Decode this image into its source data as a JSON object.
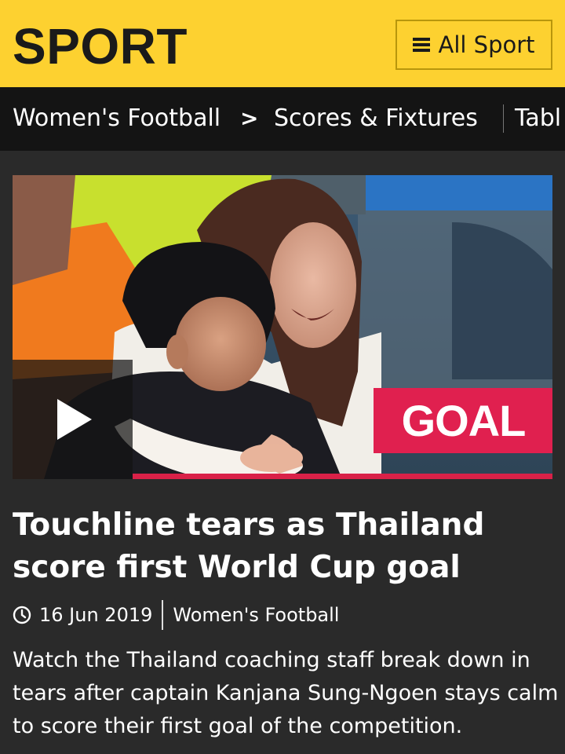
{
  "header": {
    "brand": "SPORT",
    "menu_label": "All Sport",
    "brand_color": "#fdd130"
  },
  "nav": {
    "section": "Women's Football",
    "chevron": ">",
    "items": [
      "Scores & Fixtures",
      "Tabl"
    ]
  },
  "video": {
    "badge": "GOAL",
    "play_icon": "play-icon",
    "badge_color": "#e0204f"
  },
  "article": {
    "headline": "Touchline tears as Thailand score first World Cup goal",
    "date": "16 Jun 2019",
    "category": "Women's Football",
    "summary": "Watch the Thailand coaching staff break down in tears after captain Kanjana Sung-Ngoen stays calm to score their first goal of the competition."
  }
}
